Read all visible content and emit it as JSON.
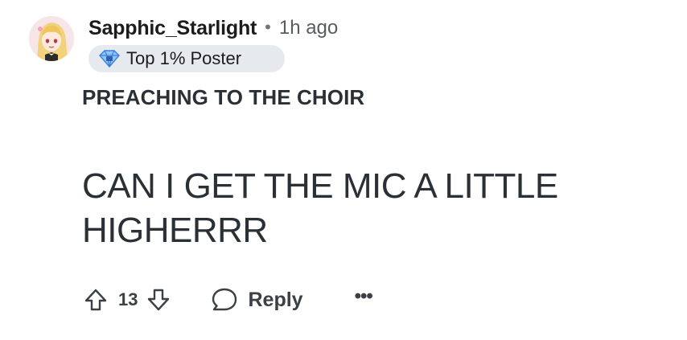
{
  "comment": {
    "author": "Sapphic_Starlight",
    "separator": "•",
    "time": "1h ago",
    "flair": {
      "label": "Top 1% Poster",
      "icon": "diamond-trophy-icon",
      "background": "#e6eaee",
      "icon_color": "#4a90e2"
    },
    "title": "PREACHING TO THE CHOIR",
    "body": "CAN I GET THE MIC A LITTLE HIGHERRR"
  },
  "actions": {
    "upvote_icon": "arrow-up-icon",
    "score": "13",
    "downvote_icon": "arrow-down-icon",
    "reply_icon": "chat-bubble-icon",
    "reply_label": "Reply",
    "more_label": "•••"
  },
  "colors": {
    "text_primary": "#1c1c1c",
    "text_body": "#2a3035",
    "text_muted": "#575c61",
    "action_gray": "#3a4046"
  }
}
